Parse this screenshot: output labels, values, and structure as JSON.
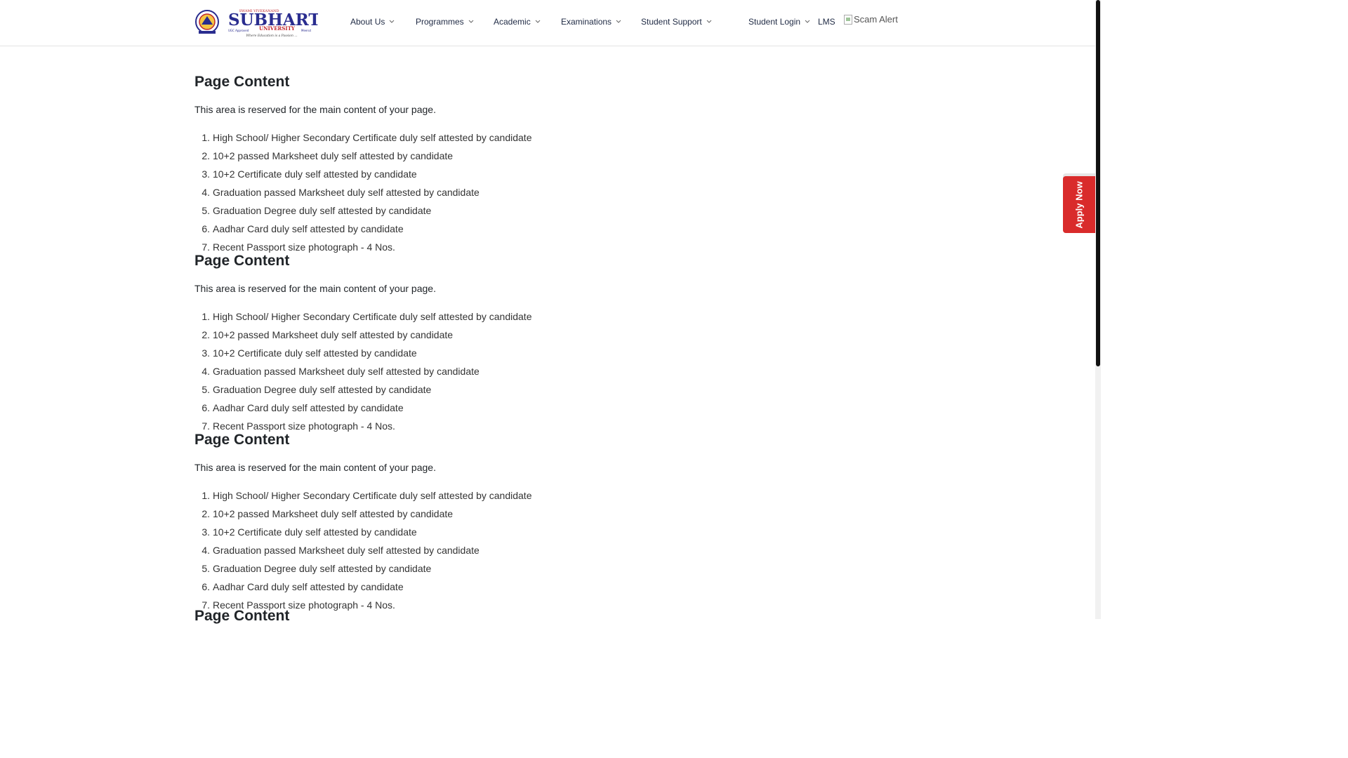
{
  "header": {
    "logo_text": "SUBHARTI UNIVERSITY",
    "logo_tagline": "Where Education is a Passion ...",
    "logo_small_top": "SWAMI VIVEKANAND",
    "logo_small_left": "UGC Approved",
    "logo_small_right": "Meerut",
    "nav": [
      {
        "label": "About Us"
      },
      {
        "label": "Programmes"
      },
      {
        "label": "Academic"
      },
      {
        "label": "Examinations"
      },
      {
        "label": "Student Support"
      },
      {
        "label": "Student Login"
      },
      {
        "label": "LMS"
      }
    ],
    "scam_alert_alt": "Scam Alert"
  },
  "sections": [
    {
      "title": "Page Content",
      "intro": "This area is reserved for the main content of your page.",
      "items": [
        "High School/ Higher Secondary Certificate duly self attested by candidate",
        "10+2 passed Marksheet duly self attested by candidate",
        "10+2 Certificate duly self attested by candidate",
        "Graduation passed Marksheet duly self attested by candidate",
        "Graduation Degree duly self attested by candidate",
        "Aadhar Card duly self attested by candidate",
        "Recent Passport size photograph - 4 Nos."
      ]
    },
    {
      "title": "Page Content",
      "intro": "This area is reserved for the main content of your page.",
      "items": [
        "High School/ Higher Secondary Certificate duly self attested by candidate",
        "10+2 passed Marksheet duly self attested by candidate",
        "10+2 Certificate duly self attested by candidate",
        "Graduation passed Marksheet duly self attested by candidate",
        "Graduation Degree duly self attested by candidate",
        "Aadhar Card duly self attested by candidate",
        "Recent Passport size photograph - 4 Nos."
      ]
    },
    {
      "title": "Page Content",
      "intro": "This area is reserved for the main content of your page.",
      "items": [
        "High School/ Higher Secondary Certificate duly self attested by candidate",
        "10+2 passed Marksheet duly self attested by candidate",
        "10+2 Certificate duly self attested by candidate",
        "Graduation passed Marksheet duly self attested by candidate",
        "Graduation Degree duly self attested by candidate",
        "Aadhar Card duly self attested by candidate",
        "Recent Passport size photograph - 4 Nos."
      ]
    },
    {
      "title": "Page Content"
    }
  ],
  "apply_label": "Apply Now",
  "colors": {
    "apply_bg": "#d92b2b",
    "logo_blue": "#2a2d8f",
    "logo_red": "#c0272d"
  }
}
